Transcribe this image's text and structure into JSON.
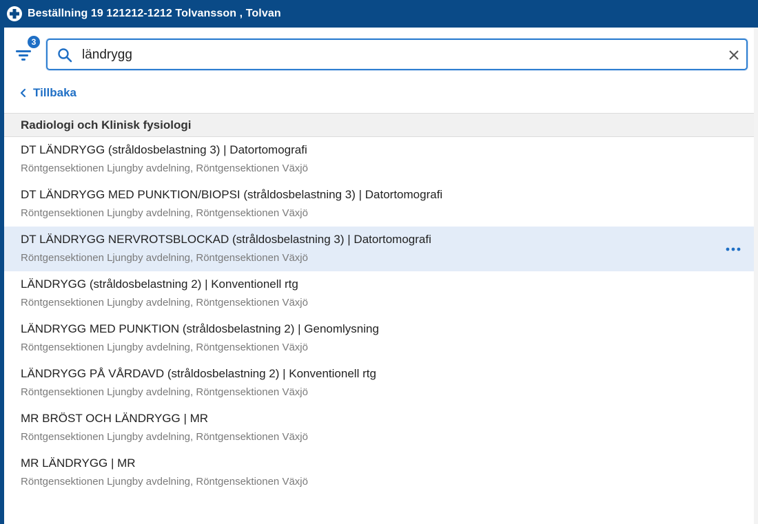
{
  "window": {
    "title": "Beställning 19 121212-1212 Tolvansson , Tolvan"
  },
  "filter": {
    "badge_count": "3"
  },
  "search": {
    "value": "ländrygg",
    "placeholder": ""
  },
  "nav": {
    "back_label": "Tillbaka"
  },
  "group": {
    "header": "Radiologi och Klinisk fysiologi"
  },
  "results": [
    {
      "title": "DT LÄNDRYGG (stråldosbelastning 3) | Datortomografi",
      "subtitle": "Röntgensektionen Ljungby avdelning, Röntgensektionen Växjö"
    },
    {
      "title": "DT LÄNDRYGG MED PUNKTION/BIOPSI (stråldosbelastning 3) | Datortomografi",
      "subtitle": "Röntgensektionen Ljungby avdelning, Röntgensektionen Växjö"
    },
    {
      "title": "DT LÄNDRYGG NERVROTSBLOCKAD (stråldosbelastning 3) | Datortomografi",
      "subtitle": "Röntgensektionen Ljungby avdelning, Röntgensektionen Växjö",
      "selected": true
    },
    {
      "title": "LÄNDRYGG (stråldosbelastning 2) | Konventionell rtg",
      "subtitle": "Röntgensektionen Ljungby avdelning, Röntgensektionen Växjö"
    },
    {
      "title": "LÄNDRYGG MED PUNKTION (stråldosbelastning 2) | Genomlysning",
      "subtitle": "Röntgensektionen Ljungby avdelning, Röntgensektionen Växjö"
    },
    {
      "title": "LÄNDRYGG PÅ VÅRDAVD (stråldosbelastning 2) | Konventionell rtg",
      "subtitle": "Röntgensektionen Ljungby avdelning, Röntgensektionen Växjö"
    },
    {
      "title": "MR BRÖST OCH LÄNDRYGG | MR",
      "subtitle": "Röntgensektionen Ljungby avdelning, Röntgensektionen Växjö"
    },
    {
      "title": "MR LÄNDRYGG | MR",
      "subtitle": "Röntgensektionen Ljungby avdelning, Röntgensektionen Växjö"
    }
  ],
  "colors": {
    "titlebar": "#0a4a87",
    "accent": "#1f6fc5",
    "selected_row": "#e3ecf8"
  },
  "icons": {
    "title": "medical-cross-icon",
    "filter": "filter-icon",
    "search": "search-icon",
    "clear": "close-icon",
    "back": "chevron-left-icon",
    "more": "more-horizontal-icon"
  }
}
